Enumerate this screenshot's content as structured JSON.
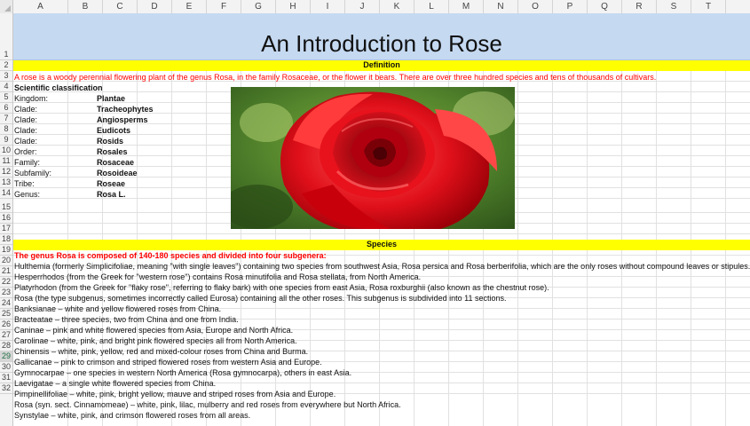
{
  "columns": [
    "A",
    "B",
    "C",
    "D",
    "E",
    "F",
    "G",
    "H",
    "I",
    "J",
    "K",
    "L",
    "M",
    "N",
    "O",
    "P",
    "Q",
    "R",
    "S",
    "T"
  ],
  "rows": [
    "1",
    "2",
    "3",
    "4",
    "5",
    "6",
    "7",
    "8",
    "9",
    "10",
    "11",
    "12",
    "13",
    "14",
    "15",
    "16",
    "17",
    "18",
    "19",
    "20",
    "21",
    "22",
    "23",
    "24",
    "25",
    "26",
    "27",
    "28",
    "29",
    "30",
    "31",
    "32"
  ],
  "selected_row": "29",
  "title": "An Introduction to Rose",
  "definition_header": "Definition",
  "definition_text": "A rose is a woody perennial flowering plant of the genus Rosa, in the family Rosaceae, or the flower it bears. There are over three hundred species and tens of thousands of cultivars.",
  "classification_header": "Scientific classification",
  "classification": [
    {
      "label": "Kingdom:",
      "value": "Plantae"
    },
    {
      "label": "Clade:",
      "value": "Tracheophytes"
    },
    {
      "label": "Clade:",
      "value": "Angiosperms"
    },
    {
      "label": "Clade:",
      "value": "Eudicots"
    },
    {
      "label": "Clade:",
      "value": "Rosids"
    },
    {
      "label": "Order:",
      "value": "Rosales"
    },
    {
      "label": "Family:",
      "value": "Rosaceae"
    },
    {
      "label": "Subfamily:",
      "value": "Rosoideae"
    },
    {
      "label": "Tribe:",
      "value": "Roseae"
    },
    {
      "label": "Genus:",
      "value": "Rosa L."
    }
  ],
  "species_header": "Species",
  "species_intro": "The genus Rosa is composed of 140-180 species and divided into four subgenera:",
  "species_lines": [
    "Hulthemia (formerly Simplicifoliae, meaning \"with single leaves\") containing two species from southwest Asia, Rosa persica and Rosa berberifolia, which are the only roses without compound leaves or stipules.",
    "Hesperrhodos (from the Greek for \"western rose\") contains Rosa minutifolia and Rosa stellata, from North America.",
    "Platyrhodon (from the Greek for \"flaky rose\", referring to flaky bark) with one species from east Asia, Rosa roxburghii (also known as the chestnut rose).",
    "Rosa (the type subgenus, sometimes incorrectly called Eurosa) containing all the other roses. This subgenus is subdivided into 11 sections.",
    "Banksianae – white and yellow flowered roses from China.",
    "Bracteatae – three species, two from China and one from India.",
    "Caninae – pink and white flowered species from Asia, Europe and North Africa.",
    "Carolinae – white, pink, and bright pink flowered species all from North America.",
    "Chinensis – white, pink, yellow, red and mixed-colour roses from China and Burma.",
    "Gallicanae – pink to crimson and striped flowered roses from western Asia and Europe.",
    "Gymnocarpae – one species in western North America (Rosa gymnocarpa), others in east Asia.",
    "Laevigatae – a single white flowered species from China.",
    "Pimpinellifoliae – white, pink, bright yellow, mauve and striped roses from Asia and Europe.",
    "Rosa (syn. sect. Cinnamomeae) – white, pink, lilac, mulberry and red roses from everywhere but North Africa.",
    "Synstylae – white, pink, and crimson flowered roses from all areas."
  ],
  "colors": {
    "title_fill": "#c5d9f1",
    "header_fill": "#ffff00",
    "accent_red": "#ff0000"
  }
}
